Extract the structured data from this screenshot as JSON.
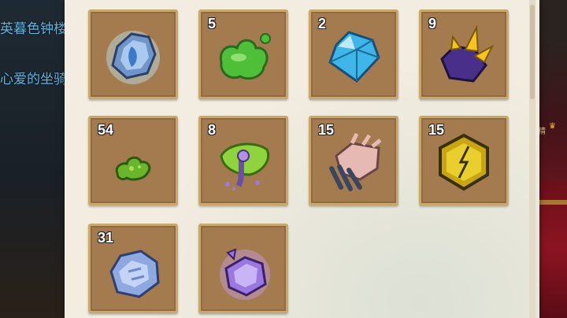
{
  "background": {
    "side_texts": [
      "英暮色钟楼",
      "心爱的坐骑"
    ],
    "right_label": "精"
  },
  "inventory": {
    "slots": [
      {
        "name": "blue-crystal-ore",
        "quantity": ""
      },
      {
        "name": "green-slime",
        "quantity": "5"
      },
      {
        "name": "diamond",
        "quantity": "2"
      },
      {
        "name": "purple-gold-crystal",
        "quantity": "9"
      },
      {
        "name": "green-moss",
        "quantity": "54"
      },
      {
        "name": "poison-fungus",
        "quantity": "8"
      },
      {
        "name": "beast-claw",
        "quantity": "15"
      },
      {
        "name": "gold-hexagon-gem",
        "quantity": "15"
      },
      {
        "name": "frost-ore",
        "quantity": "31"
      },
      {
        "name": "purple-glowing-ore",
        "quantity": ""
      }
    ]
  }
}
